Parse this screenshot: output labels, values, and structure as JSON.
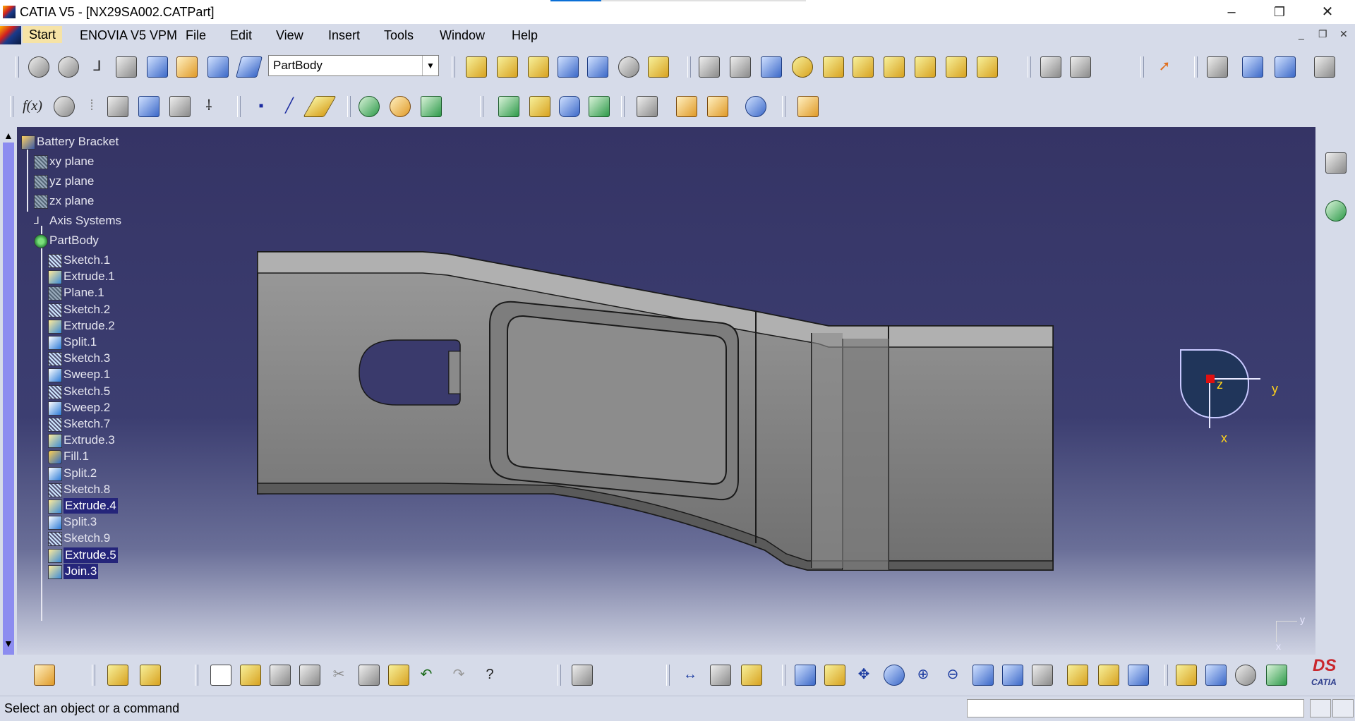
{
  "window": {
    "title": "CATIA V5 - [NX29SA002.CATPart]",
    "controls": {
      "minimize": "–",
      "restore": "❐",
      "close": "✕"
    }
  },
  "menubar": {
    "items": [
      "Start",
      "ENOVIA V5 VPM",
      "File",
      "Edit",
      "View",
      "Insert",
      "Tools",
      "Window",
      "Help"
    ],
    "mdi_controls": [
      "_",
      "❐",
      "✕"
    ]
  },
  "toolbar": {
    "body_selector": "PartBody"
  },
  "spec_tree": {
    "root": "Battery Bracket",
    "planes": [
      "xy plane",
      "yz plane",
      "zx plane"
    ],
    "axis_systems": "Axis Systems",
    "body": "PartBody",
    "features": [
      {
        "label": "Sketch.1",
        "kind": "sketch",
        "highlighted": false
      },
      {
        "label": "Extrude.1",
        "kind": "extrude",
        "highlighted": false
      },
      {
        "label": "Plane.1",
        "kind": "plane",
        "highlighted": false
      },
      {
        "label": "Sketch.2",
        "kind": "sketch",
        "highlighted": false
      },
      {
        "label": "Extrude.2",
        "kind": "extrude",
        "highlighted": false
      },
      {
        "label": "Split.1",
        "kind": "split",
        "highlighted": false
      },
      {
        "label": "Sketch.3",
        "kind": "sketch",
        "highlighted": false
      },
      {
        "label": "Sweep.1",
        "kind": "sweep",
        "highlighted": false
      },
      {
        "label": "Sketch.5",
        "kind": "sketch",
        "highlighted": false
      },
      {
        "label": "Sweep.2",
        "kind": "sweep",
        "highlighted": false
      },
      {
        "label": "Sketch.7",
        "kind": "sketch",
        "highlighted": false
      },
      {
        "label": "Extrude.3",
        "kind": "extrude",
        "highlighted": false
      },
      {
        "label": "Fill.1",
        "kind": "fill",
        "highlighted": false
      },
      {
        "label": "Split.2",
        "kind": "split",
        "highlighted": false
      },
      {
        "label": "Sketch.8",
        "kind": "sketch",
        "highlighted": false
      },
      {
        "label": "Extrude.4",
        "kind": "extrude",
        "highlighted": true
      },
      {
        "label": "Split.3",
        "kind": "split",
        "highlighted": false
      },
      {
        "label": "Sketch.9",
        "kind": "sketch",
        "highlighted": false
      },
      {
        "label": "Extrude.5",
        "kind": "extrude",
        "highlighted": true
      },
      {
        "label": "Join.3",
        "kind": "join",
        "highlighted": true
      }
    ]
  },
  "compass": {
    "z_label": "z",
    "y_label": "y",
    "x_label": "x"
  },
  "corner_axes": {
    "y": "y",
    "x": "x"
  },
  "status": {
    "message": "Select an object or a command"
  },
  "brand": {
    "ds": "DS",
    "name": "CATIA"
  },
  "colors": {
    "viewport_top": "#353465",
    "viewport_bottom": "#cfd3e3",
    "part": "#8a8a8a",
    "selection": "#25257a",
    "start_menu": "#f6e3a6"
  }
}
